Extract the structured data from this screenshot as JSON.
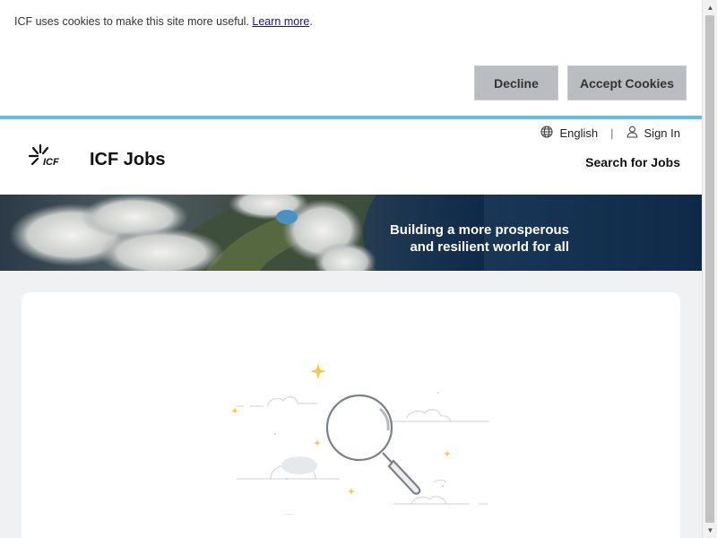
{
  "cookie_banner": {
    "message": "ICF uses cookies to make this site more useful.",
    "learn_more": "Learn more",
    "period": ".",
    "decline_label": "Decline",
    "accept_label": "Accept Cookies"
  },
  "header": {
    "logo_text": "ICF",
    "title": "ICF Jobs",
    "language_label": "English",
    "separator": "|",
    "sign_in_label": "Sign In",
    "search_jobs_label": "Search for Jobs"
  },
  "hero": {
    "line1": "Building a more prosperous",
    "line2": "and resilient world for all"
  },
  "colors": {
    "accent_rule": "#5bc0eb",
    "cookie_button_bg": "#b9bcc0",
    "page_bg": "#f0f1f2",
    "sparkle": "#f5c84c"
  },
  "icons": {
    "language": "globe-icon",
    "sign_in": "user-icon",
    "illustration": "magnifying-glass-icon"
  }
}
